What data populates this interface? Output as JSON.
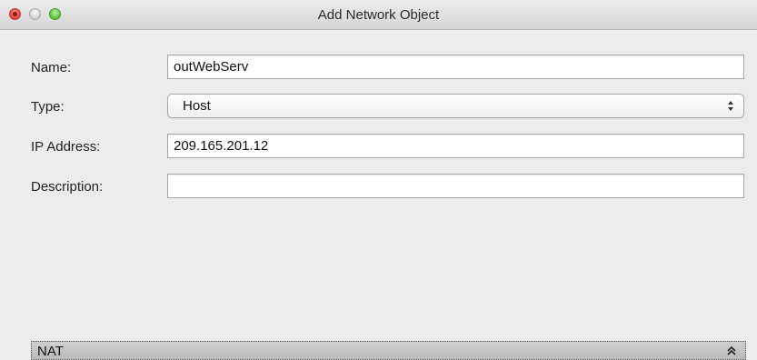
{
  "window": {
    "title": "Add Network Object"
  },
  "form": {
    "name_label": "Name:",
    "name_value": "outWebServ",
    "type_label": "Type:",
    "type_value": "Host",
    "ip_label": "IP Address:",
    "ip_value": "209.165.201.12",
    "description_label": "Description:",
    "description_value": ""
  },
  "nat": {
    "label": "NAT",
    "icon": "double-chevron-up-icon"
  },
  "icons": {
    "close": "close-button-icon",
    "minimize": "minimize-button-icon",
    "zoom": "zoom-button-icon",
    "select_arrows": "updown-arrows-icon"
  },
  "colors": {
    "close": "#e0443e",
    "zoom": "#5cbf3c",
    "background": "#ececec"
  }
}
